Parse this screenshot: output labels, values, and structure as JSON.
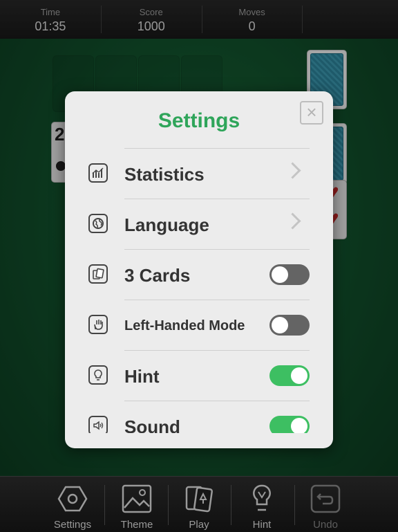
{
  "topbar": {
    "time": {
      "label": "Time",
      "value": "01:35"
    },
    "score": {
      "label": "Score",
      "value": "1000"
    },
    "moves": {
      "label": "Moves",
      "value": "0"
    }
  },
  "board": {
    "visible_card_rank": "2"
  },
  "settings": {
    "title": "Settings",
    "close_icon": "close-icon",
    "items": [
      {
        "label": "Statistics",
        "icon": "chart-icon",
        "control": "chevron"
      },
      {
        "label": "Language",
        "icon": "globe-icon",
        "control": "chevron"
      },
      {
        "label": "3 Cards",
        "icon": "cards-icon",
        "control": "toggle",
        "on": false
      },
      {
        "label": "Left-Handed Mode",
        "icon": "hand-icon",
        "control": "toggle",
        "on": false
      },
      {
        "label": "Hint",
        "icon": "lightbulb-icon",
        "control": "toggle",
        "on": true
      },
      {
        "label": "Sound",
        "icon": "speaker-icon",
        "control": "toggle",
        "on": true
      }
    ]
  },
  "toolbar": {
    "settings_label": "Settings",
    "theme_label": "Theme",
    "play_label": "Play",
    "hint_label": "Hint",
    "undo_label": "Undo"
  },
  "colors": {
    "accent": "#2fa55a",
    "toggle_on": "#3dbf62",
    "toggle_off": "#646464",
    "felt": "#145a31"
  }
}
